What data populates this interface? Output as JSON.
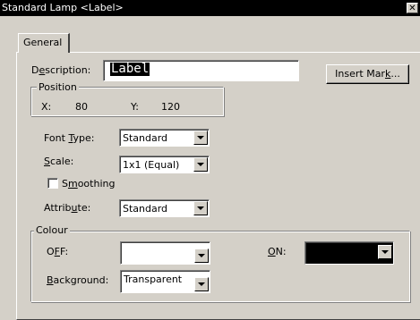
{
  "window": {
    "title": "Standard Lamp <Label>",
    "close_label": "✕"
  },
  "tabs": [
    {
      "label": "General",
      "selected": true
    }
  ],
  "description": {
    "label_pre": "D",
    "label_u": "e",
    "label_post": "scription:",
    "value": "Label"
  },
  "insert_mark": {
    "label_pre": "Insert Mar",
    "label_u": "k",
    "label_post": "..."
  },
  "position": {
    "title": "Position",
    "x_label": "X:",
    "x_value": "80",
    "y_label": "Y:",
    "y_value": "120"
  },
  "font_type": {
    "label_pre": "Font ",
    "label_u": "T",
    "label_post": "ype:",
    "value": "Standard"
  },
  "scale": {
    "label_pre": "",
    "label_u": "S",
    "label_post": "cale:",
    "value": "1x1 (Equal)"
  },
  "smoothing": {
    "label_pre": "S",
    "label_u": "m",
    "label_post": "oothing",
    "checked": false
  },
  "attribute": {
    "label_pre": "Attrib",
    "label_u": "u",
    "label_post": "te:",
    "value": "Standard"
  },
  "colour": {
    "title": "Colour",
    "off": {
      "label_pre": "O",
      "label_u": "F",
      "label_post": "F:",
      "value": "",
      "color": "#ffffff"
    },
    "on": {
      "label_pre": "",
      "label_u": "O",
      "label_post": "N:",
      "value": "",
      "color": "#000000"
    },
    "background": {
      "label_pre": "",
      "label_u": "B",
      "label_post": "ackground:",
      "value": "Transparent"
    }
  }
}
